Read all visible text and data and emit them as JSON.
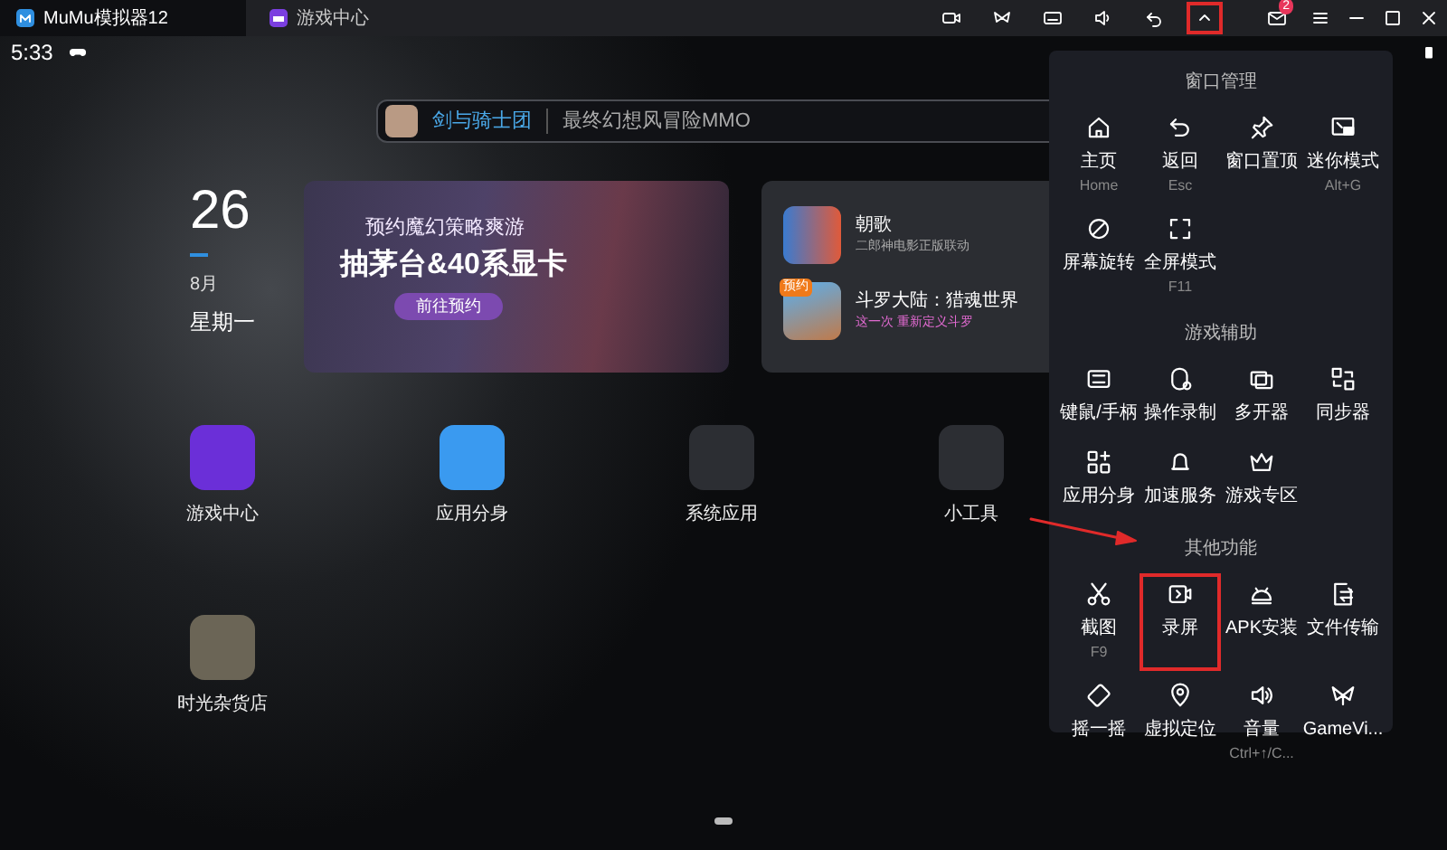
{
  "title_bar": {
    "tabs": [
      {
        "label": "MuMu模拟器12",
        "selected": true
      },
      {
        "label": "游戏中心",
        "selected": false
      }
    ],
    "toolbar": [
      {
        "highlighted": false
      },
      {
        "highlighted": false
      },
      {
        "highlighted": false
      },
      {
        "highlighted": false
      },
      {
        "highlighted": false
      },
      {
        "highlighted": true
      }
    ],
    "mail_badge": "2"
  },
  "status_bar": {
    "time": "5:33"
  },
  "search": {
    "app_name": "剑与骑士团",
    "slogan": "最终幻想风冒险MMO"
  },
  "date": {
    "day": "26",
    "month": "8月",
    "weekday": "星期一"
  },
  "banner": {
    "headline": "预约魔幻策略爽游",
    "title": "抽茅台&40系显卡",
    "button": "前往预约"
  },
  "game_card": {
    "games": [
      {
        "name": "朝歌",
        "subtitle": "二郎神电影正版联动"
      },
      {
        "name": "斗罗大陆：猎魂世界",
        "subtitle": "这一次 重新定义斗罗",
        "badge": "预约"
      }
    ]
  },
  "apps": [
    {
      "label": "游戏中心"
    },
    {
      "label": "应用分身"
    },
    {
      "label": "系统应用"
    },
    {
      "label": "小工具"
    },
    {
      "label": "时光杂货店"
    }
  ],
  "menu": {
    "sections": [
      {
        "title": "窗口管理",
        "items": [
          {
            "label": "主页",
            "shortcut": "Home",
            "highlighted": false
          },
          {
            "label": "返回",
            "shortcut": "Esc",
            "highlighted": false
          },
          {
            "label": "窗口置顶",
            "highlighted": false
          },
          {
            "label": "迷你模式",
            "shortcut": "Alt+G",
            "highlighted": false
          },
          {
            "label": "屏幕旋转",
            "highlighted": false
          },
          {
            "label": "全屏模式",
            "shortcut": "F11",
            "highlighted": false
          }
        ]
      },
      {
        "title": "游戏辅助",
        "items": [
          {
            "label": "键鼠/手柄",
            "highlighted": false
          },
          {
            "label": "操作录制",
            "highlighted": false
          },
          {
            "label": "多开器",
            "highlighted": false
          },
          {
            "label": "同步器",
            "highlighted": false
          },
          {
            "label": "应用分身",
            "highlighted": false
          },
          {
            "label": "加速服务",
            "highlighted": false
          },
          {
            "label": "游戏专区",
            "highlighted": false
          }
        ]
      },
      {
        "title": "其他功能",
        "items": [
          {
            "label": "截图",
            "shortcut": "F9",
            "highlighted": false
          },
          {
            "label": "录屏",
            "highlighted": true
          },
          {
            "label": "APK安装",
            "highlighted": false
          },
          {
            "label": "文件传输",
            "highlighted": false
          },
          {
            "label": "摇一摇",
            "highlighted": false
          },
          {
            "label": "虚拟定位",
            "highlighted": false
          },
          {
            "label": "音量",
            "shortcut": "Ctrl+↑/C...",
            "highlighted": false
          },
          {
            "label": "GameVi...",
            "highlighted": false
          }
        ]
      }
    ]
  }
}
